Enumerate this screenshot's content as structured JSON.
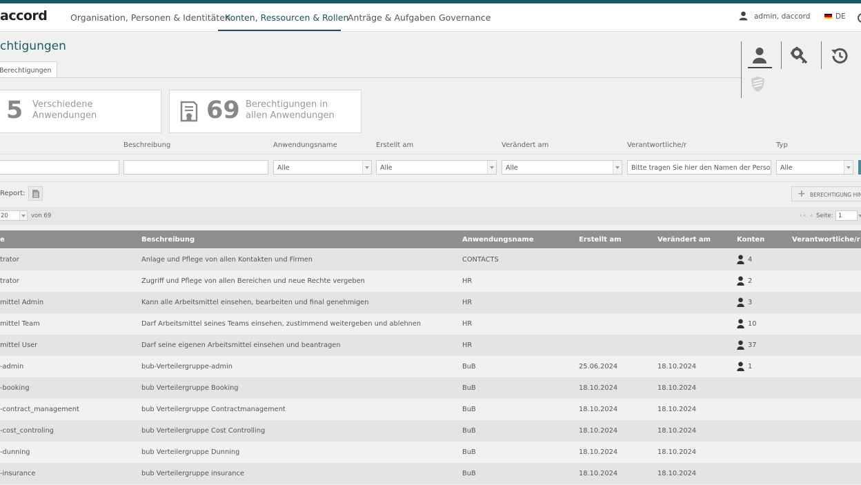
{
  "app": {
    "logo": "accord"
  },
  "nav": [
    {
      "label": "Organisation, Personen & Identitäten"
    },
    {
      "label": "Konten, Ressourcen & Rollen",
      "active": true
    },
    {
      "label": "Anträge & Aufgaben"
    },
    {
      "label": "Governance"
    }
  ],
  "user": {
    "label": "admin, daccord",
    "lang": "DE"
  },
  "colors": {
    "accent": "#1d5a66",
    "table_header": "#8f8f8f",
    "flag": [
      "#000000",
      "#dd0000",
      "#ffce00"
    ]
  },
  "page": {
    "title": "chtigungen",
    "tab": "Berechtigungen"
  },
  "stats": [
    {
      "number": "5",
      "line1": "Verschiedene",
      "line2": "Anwendungen"
    },
    {
      "number": "69",
      "line1": "Berechtigungen in",
      "line2": "allen Anwendungen",
      "icon": "certificate-icon"
    }
  ],
  "filters": {
    "labels": {
      "beschreibung": "Beschreibung",
      "anwendungsname": "Anwendungsname",
      "erstellt": "Erstellt am",
      "veraendert": "Verändert am",
      "verantwortliche": "Verantwortliche/r",
      "typ": "Typ"
    },
    "values": {
      "anwendungsname": "Alle",
      "erstellt": "Alle",
      "veraendert": "Alle",
      "typ": "Alle"
    },
    "verantwortliche_placeholder": "Bitte tragen Sie hier den Namen der Person e"
  },
  "toolbar": {
    "report_label": "Report:",
    "add_label": "BERECHTIGUNG HIN"
  },
  "pager": {
    "page_size": "20",
    "total": "von 69",
    "nav": "‹‹ ‹",
    "seite_label": "Seite:",
    "page": "1"
  },
  "table": {
    "headers": {
      "name": "e",
      "beschreibung": "Beschreibung",
      "anwendungsname": "Anwendungsname",
      "erstellt": "Erstellt am",
      "veraendert": "Verändert am",
      "konten": "Konten",
      "verantwortliche": "Verantwortliche/r"
    },
    "rows": [
      {
        "name": "trator",
        "beschreibung": "Anlage und Pflege von allen Kontakten und Firmen",
        "anwendung": "CONTACTS",
        "erstellt": "",
        "veraendert": "",
        "konten": "4"
      },
      {
        "name": "trator",
        "beschreibung": "Zugriff und Pflege von allen Bereichen und neue Rechte vergeben",
        "anwendung": "HR",
        "erstellt": "",
        "veraendert": "",
        "konten": "2"
      },
      {
        "name": "mittel Admin",
        "beschreibung": "Kann alle Arbeitsmittel einsehen, bearbeiten und final genehmigen",
        "anwendung": "HR",
        "erstellt": "",
        "veraendert": "",
        "konten": "3"
      },
      {
        "name": "mittel Team",
        "beschreibung": "Darf Arbeitsmittel seines Teams einsehen, zustimmend weitergeben und ablehnen",
        "anwendung": "HR",
        "erstellt": "",
        "veraendert": "",
        "konten": "10"
      },
      {
        "name": "mittel User",
        "beschreibung": "Darf seine eigenen Arbeitsmittel einsehen und beantragen",
        "anwendung": "HR",
        "erstellt": "",
        "veraendert": "",
        "konten": "37"
      },
      {
        "name": "-admin",
        "beschreibung": "bub-Verteilergruppe-admin",
        "anwendung": "BuB",
        "erstellt": "25.06.2024",
        "veraendert": "18.10.2024",
        "konten": "1"
      },
      {
        "name": "-booking",
        "beschreibung": "bub Verteilergruppe Booking",
        "anwendung": "BuB",
        "erstellt": "18.10.2024",
        "veraendert": "18.10.2024",
        "konten": ""
      },
      {
        "name": "-contract_management",
        "beschreibung": "bub Verteilergruppe Contractmanagement",
        "anwendung": "BuB",
        "erstellt": "18.10.2024",
        "veraendert": "18.10.2024",
        "konten": ""
      },
      {
        "name": "-cost_controling",
        "beschreibung": "bub Verteilergruppe Cost Controlling",
        "anwendung": "BuB",
        "erstellt": "18.10.2024",
        "veraendert": "18.10.2024",
        "konten": ""
      },
      {
        "name": "-dunning",
        "beschreibung": "bub Verteilergruppe Dunning",
        "anwendung": "BuB",
        "erstellt": "18.10.2024",
        "veraendert": "18.10.2024",
        "konten": ""
      },
      {
        "name": "-insurance",
        "beschreibung": "bub Verteilergruppe insurance",
        "anwendung": "BuB",
        "erstellt": "18.10.2024",
        "veraendert": "18.10.2024",
        "konten": ""
      }
    ]
  }
}
